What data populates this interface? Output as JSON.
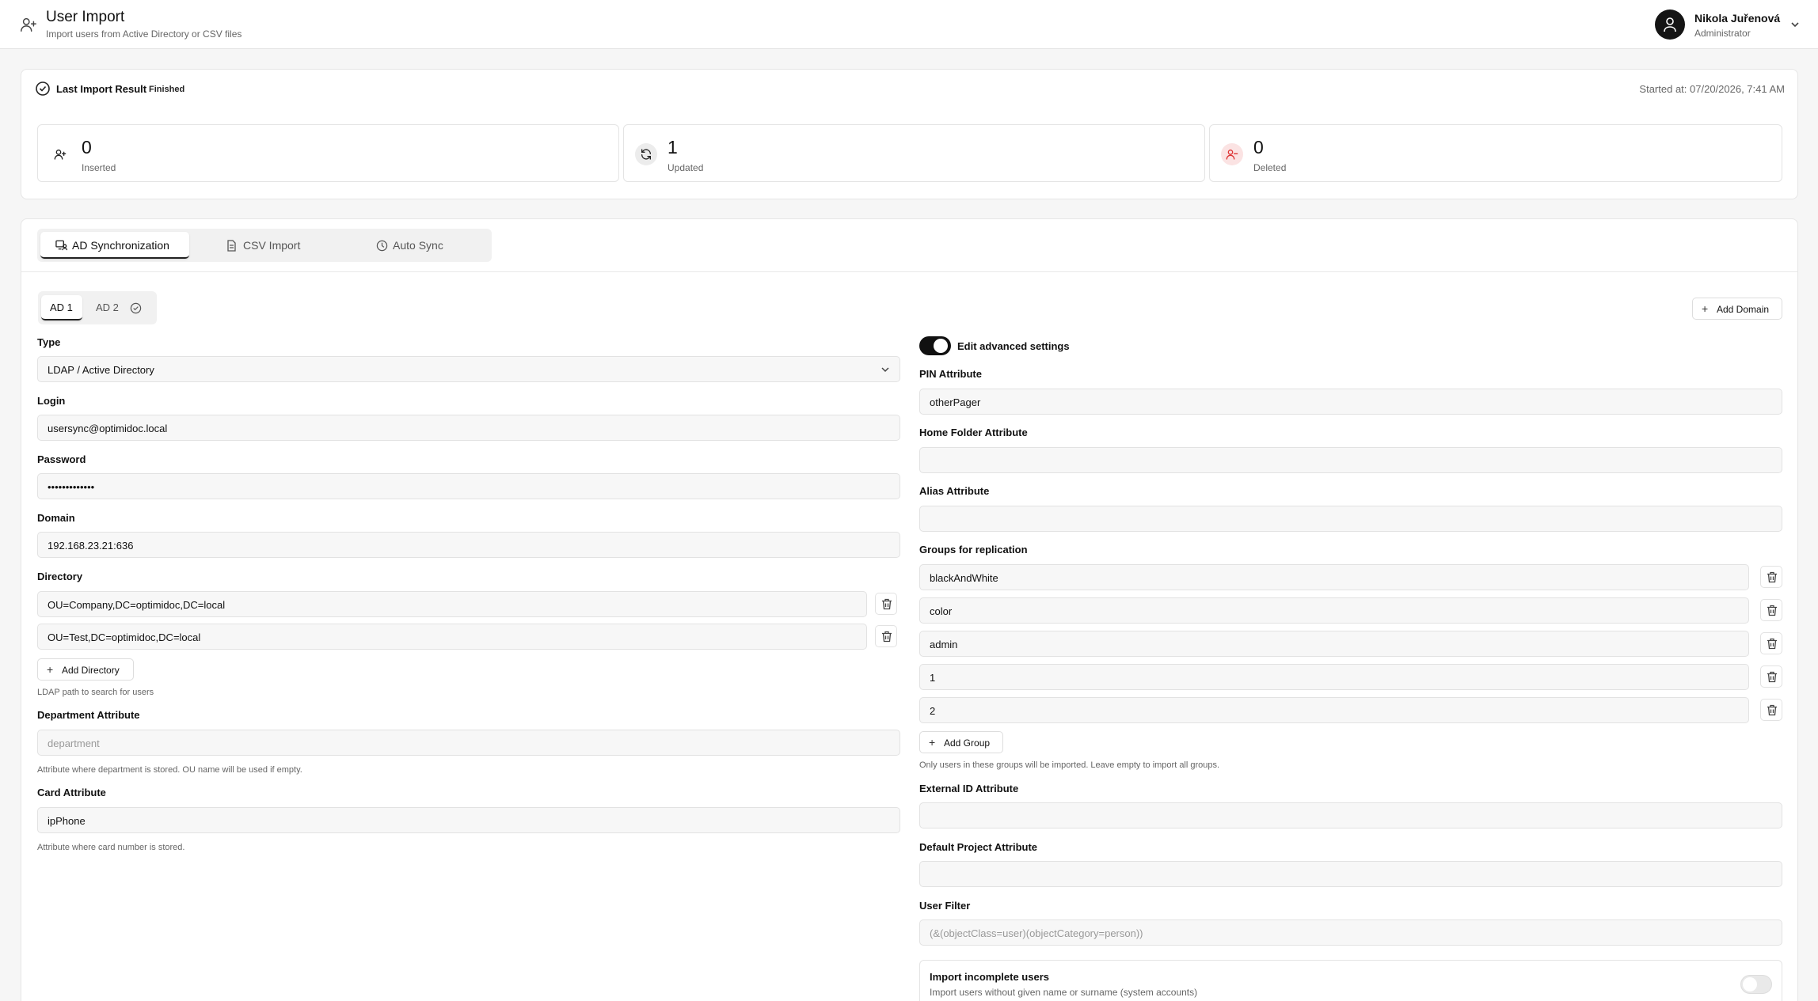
{
  "header": {
    "title": "User Import",
    "subtitle": "Import users from Active Directory or CSV files",
    "icon": "user-plus-icon",
    "user_name": "Nikola Juřenová",
    "user_role": "Administrator"
  },
  "last_import": {
    "title": "Last Import Result",
    "status": "Finished",
    "started": "Started at: 07/20/2026, 7:41 AM",
    "stats": [
      {
        "value": "0",
        "label": "Inserted",
        "icon": "user-plus-icon"
      },
      {
        "value": "1",
        "label": "Updated",
        "icon": "refresh-icon"
      },
      {
        "value": "0",
        "label": "Deleted",
        "icon": "user-minus-icon"
      }
    ]
  },
  "tabs": [
    {
      "label": "AD Synchronization",
      "icon": "monitor-user-icon",
      "active": true
    },
    {
      "label": "CSV Import",
      "icon": "file-icon",
      "active": false
    },
    {
      "label": "Auto Sync",
      "icon": "clock-icon",
      "active": false
    }
  ],
  "domains": {
    "tabs": [
      {
        "label": "AD 1"
      },
      {
        "label": "AD 2"
      }
    ],
    "add_label": "Add Domain"
  },
  "left": {
    "type_label": "Type",
    "type_value": "LDAP / Active Directory",
    "login_label": "Login",
    "login_value": "usersync@optimidoc.local",
    "password_label": "Password",
    "password_value": "•••••••••••••",
    "domain_label": "Domain",
    "domain_value": "192.168.23.21:636",
    "directory_label": "Directory",
    "directories": [
      "OU=Company,DC=optimidoc,DC=local",
      "OU=Test,DC=optimidoc,DC=local"
    ],
    "add_directory": "Add Directory",
    "directory_help": "LDAP path to search for users",
    "department_label": "Department Attribute",
    "department_placeholder": "department",
    "department_help": "Attribute where department is stored. OU name will be used if empty.",
    "card_label": "Card Attribute",
    "card_value": "ipPhone",
    "card_help": "Attribute where card number is stored."
  },
  "right": {
    "advanced_label": "Edit advanced settings",
    "advanced_on": true,
    "pin_label": "PIN Attribute",
    "pin_value": "otherPager",
    "home_label": "Home Folder Attribute",
    "home_value": "",
    "alias_label": "Alias Attribute",
    "alias_value": "",
    "groups_label": "Groups for replication",
    "groups": [
      "blackAndWhite",
      "color",
      "admin",
      "1",
      "2"
    ],
    "add_group": "Add Group",
    "groups_help": "Only users in these groups will be imported. Leave empty to import all groups.",
    "external_label": "External ID Attribute",
    "external_value": "",
    "project_label": "Default Project Attribute",
    "project_value": "",
    "filter_label": "User Filter",
    "filter_placeholder": "(&(objectClass=user)(objectCategory=person))",
    "incomplete_title": "Import incomplete users",
    "incomplete_desc": "Import users without given name or surname (system accounts)",
    "incomplete_on": false
  }
}
